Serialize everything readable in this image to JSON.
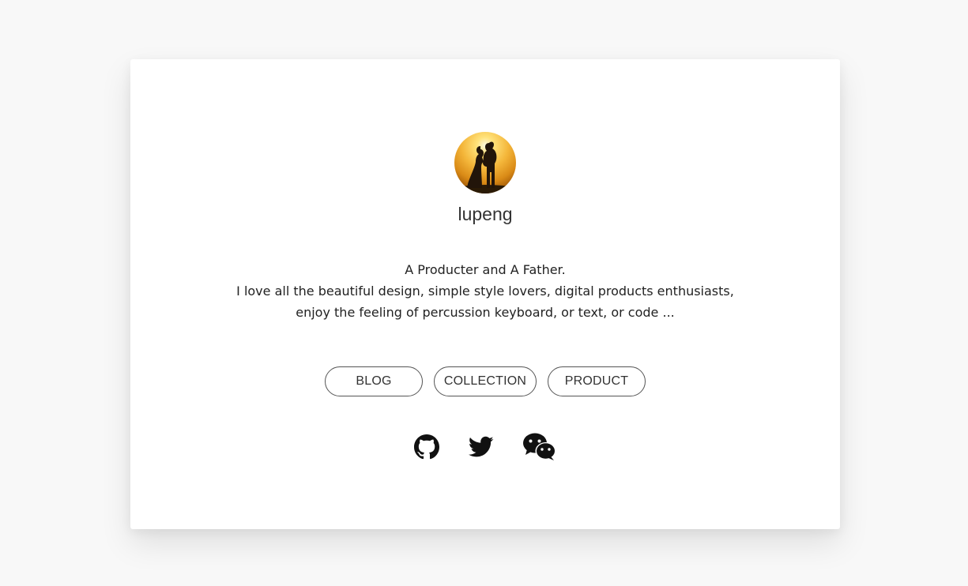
{
  "profile": {
    "name": "lupeng",
    "avatar_icon": "profile-photo-couple-silhouette"
  },
  "bio": {
    "line1": "A Producter and A Father.",
    "line2": "I love all the beautiful design, simple style lovers, digital products enthusiasts,",
    "line3": "enjoy the feeling of percussion keyboard, or text, or code ..."
  },
  "nav": {
    "blog": "BLOG",
    "collection": "COLLECTION",
    "product": "PRODUCT"
  },
  "social": {
    "github_icon": "github-icon",
    "twitter_icon": "twitter-icon",
    "wechat_icon": "wechat-icon"
  },
  "colors": {
    "page_background": "#f8f8f8",
    "card_background": "#ffffff",
    "text": "#222222",
    "button_border": "#555555"
  }
}
